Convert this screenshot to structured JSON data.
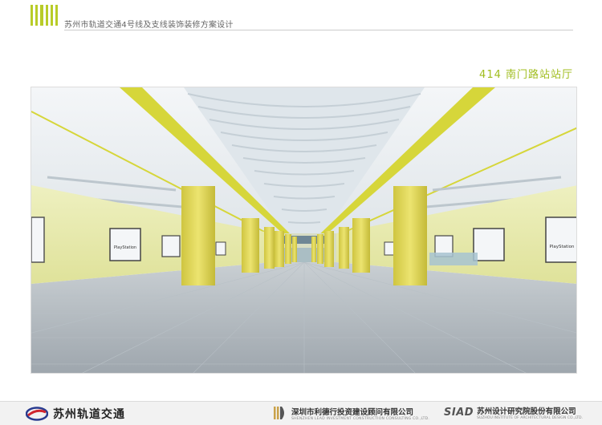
{
  "header": {
    "project_title": "苏州市轨道交通4号线及支线装饰装修方案设计",
    "accent_color": "#b8cc28"
  },
  "station": {
    "title": "414 南门路站站厅",
    "accent_color": "#a0bd1e"
  },
  "render": {
    "ad_text": "PlayStation",
    "colors": {
      "wall": "#e6e8a8",
      "column": "#e3d95a",
      "ceiling": "#eef2f4",
      "floor": "#a8b0b6",
      "stripe": "#d6d63a"
    }
  },
  "footer": {
    "logo_metro": {
      "name": "苏州轨道交通"
    },
    "logo_lead": {
      "cn": "深圳市利德行投资建设顾问有限公司",
      "en": "SHENZHEN LEAD INVESTMENT CONSTRUCTION CONSULTING CO.,LTD."
    },
    "logo_siad": {
      "abbr": "SIAD",
      "cn": "苏州设计研究院股份有限公司",
      "en": "SUZHOU INSTITUTE OF ARCHITECTURAL DESIGN CO.,LTD."
    }
  }
}
